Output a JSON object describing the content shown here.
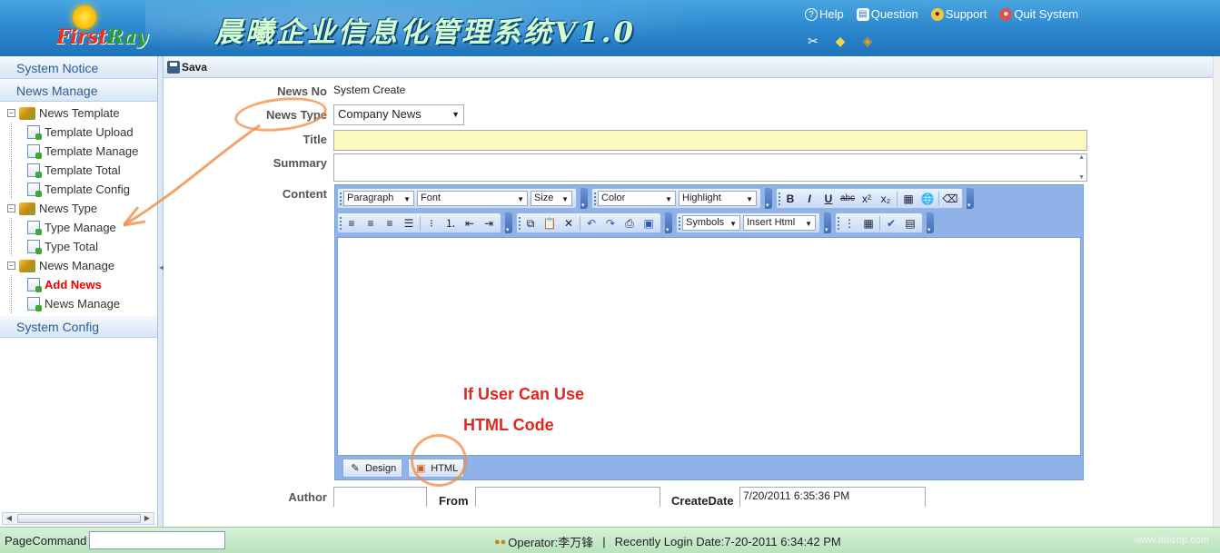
{
  "header": {
    "logo_text_a": "First",
    "logo_text_b": "Ray",
    "app_title": "晨曦企业信息化管理系统V1.0",
    "links": [
      {
        "label": "Help",
        "icon": "help-icon"
      },
      {
        "label": "Question",
        "icon": "book-icon"
      },
      {
        "label": "Support",
        "icon": "user-icon"
      },
      {
        "label": "Quit System",
        "icon": "quit-icon"
      }
    ],
    "tool_icons": [
      "tools-icon",
      "palette-icon",
      "diamond-icon"
    ]
  },
  "sidebar": {
    "sections": [
      "System Notice",
      "News Manage",
      "System Config"
    ],
    "tree": [
      {
        "label": "News Template",
        "level": 1
      },
      {
        "label": "Template Upload",
        "level": 2
      },
      {
        "label": "Template Manage",
        "level": 2
      },
      {
        "label": "Template Total",
        "level": 2
      },
      {
        "label": "Template Config",
        "level": 2
      },
      {
        "label": "News Type",
        "level": 1
      },
      {
        "label": "Type Manage",
        "level": 2
      },
      {
        "label": "Type Total",
        "level": 2
      },
      {
        "label": "News Manage",
        "level": 1
      },
      {
        "label": "Add News",
        "level": 2,
        "active": true
      },
      {
        "label": "News Manage",
        "level": 2
      }
    ]
  },
  "toolbar": {
    "save_label": "Sava"
  },
  "form": {
    "news_no_label": "News No",
    "news_no_value": "System Create",
    "news_type_label": "News Type",
    "news_type_value": "Company News",
    "title_label": "Title",
    "summary_label": "Summary",
    "content_label": "Content",
    "author_label": "Author",
    "from_label": "From",
    "createdate_label": "CreateDate",
    "createdate_value": "7/20/2011 6:35:36 PM"
  },
  "editor": {
    "paragraph": "Paragraph",
    "font": "Font",
    "size": "Size",
    "color": "Color",
    "highlight": "Highlight",
    "symbols": "Symbols",
    "insert_html": "Insert Html",
    "tab_design": "Design",
    "tab_html": "HTML"
  },
  "annotation": {
    "line1": "If User Can Use",
    "line2": "HTML Code"
  },
  "statusbar": {
    "page_command_label": "PageCommand",
    "operator": "Operator:李万锋",
    "separator": "|",
    "login_date": "Recently Login Date:7-20-2011 6:34:42 PM",
    "watermark": "www.ttbizop.com"
  },
  "colors": {
    "header_blue": "#2e8bd0",
    "sidebar_head_text": "#2d5d97",
    "active_item": "#ee0000",
    "title_field_bg": "#fbf8c0",
    "editor_frame": "#8fb3e8",
    "annotation": "#e2251f",
    "status_bar": "#c8eacb"
  }
}
